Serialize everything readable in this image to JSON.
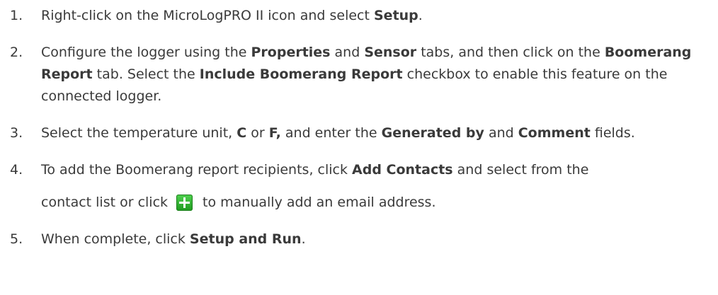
{
  "steps": [
    {
      "num": "1.",
      "parts": {
        "a": "Right-click on the MicroLogPRO II icon and select ",
        "b1": "Setup",
        "c": "."
      }
    },
    {
      "num": "2.",
      "parts": {
        "a": "Configure the logger using the ",
        "b1": "Properties",
        "c": " and ",
        "b2": "Sensor",
        "d": " tabs, and then click on the ",
        "b3": "Boomerang Report",
        "e": " tab. Select the ",
        "b4": "Include Boomerang Report",
        "f": " checkbox to enable this feature on the connected logger."
      }
    },
    {
      "num": "3.",
      "parts": {
        "a": "Select the temperature unit, ",
        "b1": "C",
        "c": " or ",
        "b2": "F,",
        "d": " and enter the ",
        "b3": "Generated by",
        "e": " and ",
        "b4": "Comment",
        "f": " fields."
      }
    },
    {
      "num": "4.",
      "parts": {
        "a": "To add the Boomerang report recipients, click ",
        "b1": "Add Contacts",
        "c": " and select from the",
        "d": "contact list or click",
        "e": "to manually add an email address."
      },
      "icon": "green-plus-icon"
    },
    {
      "num": "5.",
      "parts": {
        "a": "When complete, click ",
        "b1": "Setup and Run",
        "c": "."
      }
    }
  ]
}
